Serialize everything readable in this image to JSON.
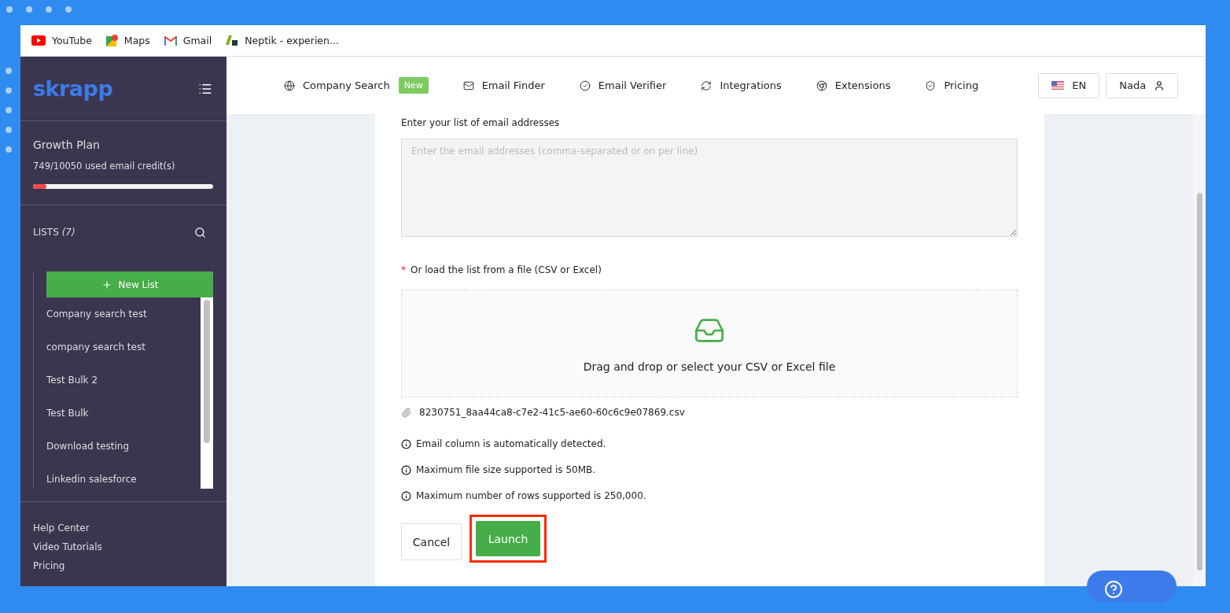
{
  "bookmarks": [
    {
      "kind": "youtube",
      "label": "YouTube"
    },
    {
      "kind": "maps",
      "label": "Maps"
    },
    {
      "kind": "gmail",
      "label": "Gmail"
    },
    {
      "kind": "neptik",
      "label": "Neptik - experien..."
    }
  ],
  "sidebar": {
    "logo": "skrapp",
    "plan": "Growth Plan",
    "credits": "749/10050 used email credit(s)",
    "level": 0.075,
    "lists_title": "LISTS",
    "lists_count": "(7)",
    "new_list": "New List",
    "lists": [
      "Company search test",
      "company search test",
      "Test Bulk 2",
      "Test Bulk",
      "Download testing",
      "Linkedin salesforce"
    ],
    "footer_links": [
      "Help Center",
      "Video Tutorials",
      "Pricing"
    ]
  },
  "nav": {
    "items": [
      {
        "kind": "globe",
        "label": "Company Search",
        "badge": "New"
      },
      {
        "kind": "mail",
        "label": "Email Finder"
      },
      {
        "kind": "check",
        "label": "Email Verifier"
      },
      {
        "kind": "sync",
        "label": "Integrations"
      },
      {
        "kind": "chrome",
        "label": "Extensions"
      },
      {
        "kind": "shield",
        "label": "Pricing"
      }
    ],
    "language": "EN",
    "user": "Nada"
  },
  "form": {
    "emails_label": "Enter your list of email addresses",
    "emails_placeholder": "Enter the email addresses (comma-separated or on per line)",
    "required_mark": "*",
    "file_label": "Or load the list from a file (CSV or Excel)",
    "dropzone_text": "Drag and drop or select your CSV or Excel file",
    "file_name": "8230751_8aa44ca8-c7e2-41c5-ae60-60c6c9e07869.csv",
    "notes": [
      "Email column is automatically detected.",
      "Maximum file size supported is 50MB.",
      "Maximum number of rows supported is 250,000."
    ],
    "cancel": "Cancel",
    "launch": {
      "label": "Launch",
      "highlighted": true
    }
  }
}
